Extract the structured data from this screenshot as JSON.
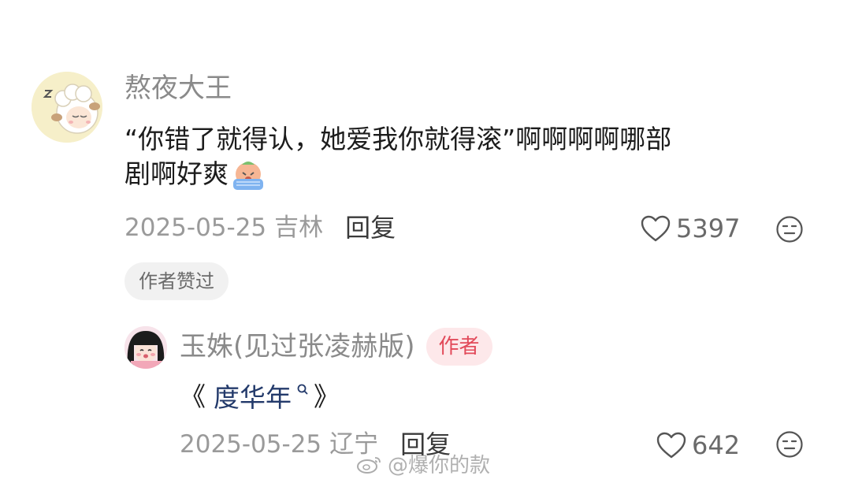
{
  "comment": {
    "username": "熬夜大王",
    "text_line1": "“你错了就得认，她爱我你就得滚”啊啊啊啊哪部",
    "text_line2": "剧啊好爽",
    "date": "2025-05-25",
    "location": "吉林",
    "reply_label": "回复",
    "like_count": "5397",
    "author_liked_label": "作者赞过"
  },
  "reply": {
    "username": "玉姝(见过张凌赫版)",
    "author_badge": "作者",
    "open_bracket": "《",
    "topic": "度华年",
    "close_bracket": "》",
    "date": "2025-05-25",
    "location": "辽宁",
    "reply_label": "回复",
    "like_count": "642"
  },
  "watermark": {
    "text": "@爆你的款"
  },
  "icons": {
    "like": "heart-outline-icon",
    "dislike": "neutral-face-icon",
    "search": "search-icon",
    "emoji": "crying-emoji-icon",
    "weibo": "weibo-logo-icon"
  }
}
